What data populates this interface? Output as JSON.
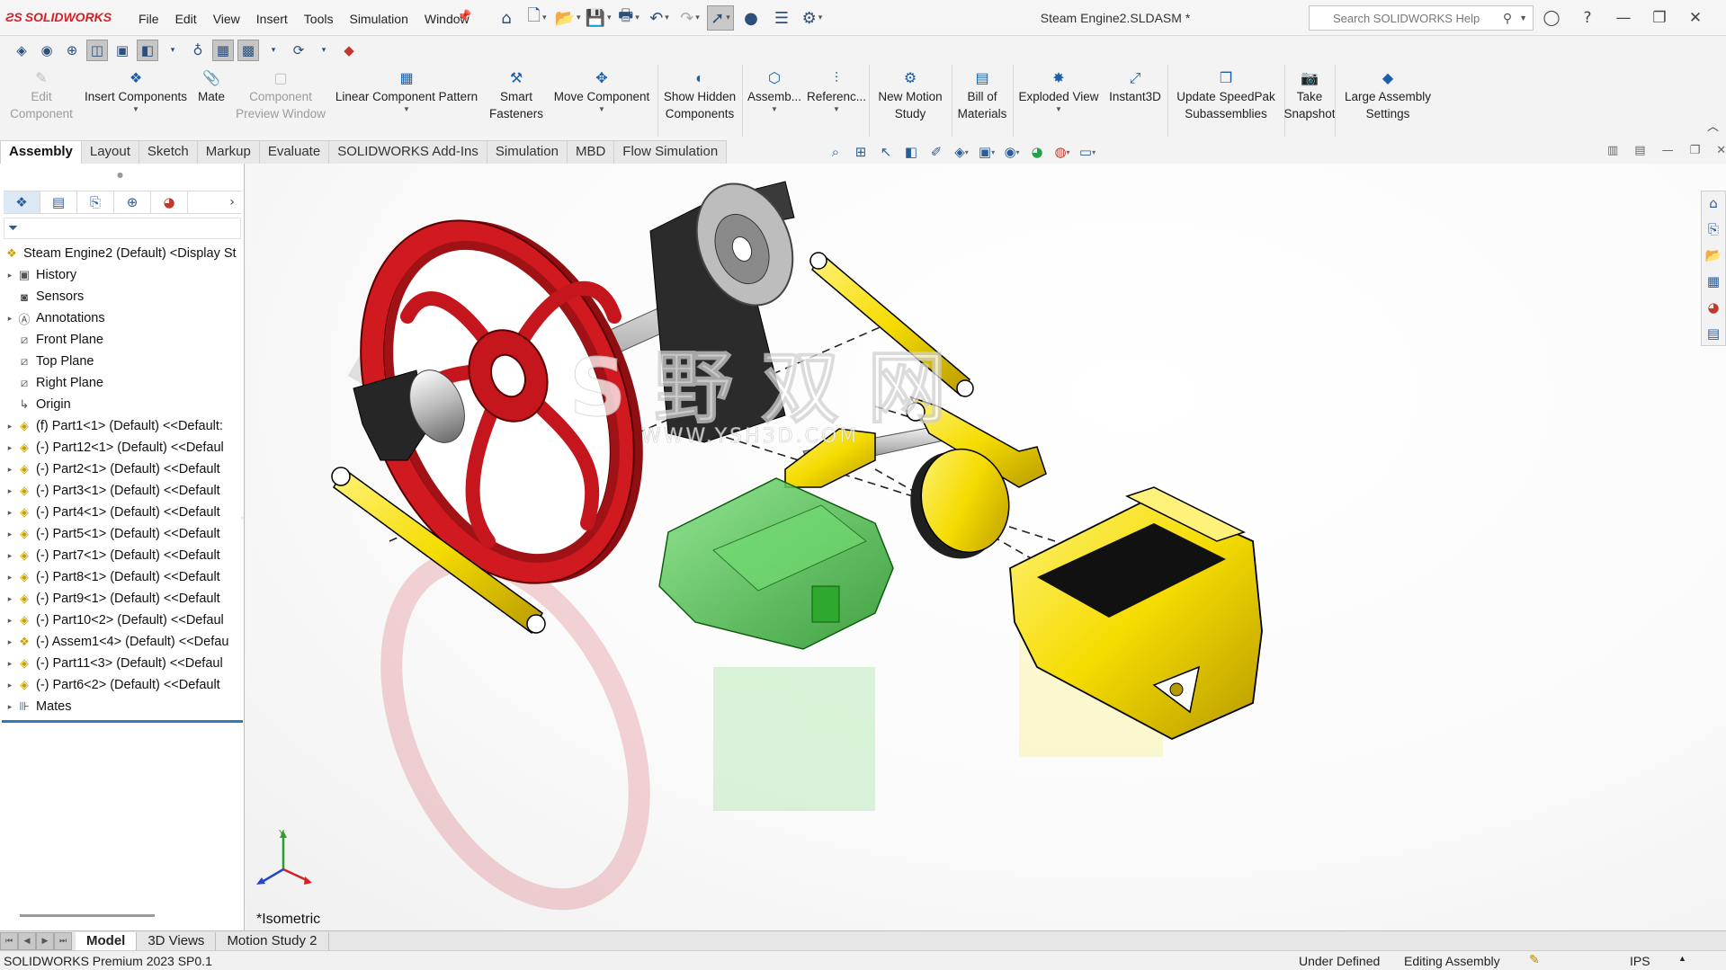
{
  "app": {
    "logo_text": "SOLIDWORKS",
    "document_title": "Steam Engine2.SLDASM *"
  },
  "menu": [
    "File",
    "Edit",
    "View",
    "Insert",
    "Tools",
    "Simulation",
    "Window"
  ],
  "quick_tools": [
    "home-icon",
    "new-document-icon",
    "open-icon",
    "save-icon",
    "print-icon",
    "undo-icon",
    "redo-icon",
    "select-icon",
    "traffic-light-icon",
    "file-properties-icon",
    "options-icon"
  ],
  "help_search": {
    "placeholder": "Search SOLIDWORKS Help"
  },
  "command_manager": {
    "commands": [
      {
        "label": "Edit\nComponent",
        "icon": "edit-component-icon",
        "enabled": false
      },
      {
        "label": "Insert Components",
        "icon": "insert-components-icon",
        "enabled": true,
        "dropdown": true
      },
      {
        "label": "Mate",
        "icon": "paperclip-icon",
        "enabled": true
      },
      {
        "label": "Component\nPreview Window",
        "icon": "preview-window-icon",
        "enabled": false
      },
      {
        "label": "Linear Component Pattern",
        "icon": "pattern-icon",
        "enabled": true,
        "dropdown": true
      },
      {
        "label": "Smart\nFasteners",
        "icon": "fasteners-icon",
        "enabled": true
      },
      {
        "label": "Move Component",
        "icon": "move-component-icon",
        "enabled": true,
        "dropdown": true
      },
      {
        "label": "Show Hidden\nComponents",
        "icon": "show-hidden-icon",
        "enabled": true
      },
      {
        "label": "Assemb...",
        "icon": "assembly-features-icon",
        "enabled": true,
        "dropdown": true
      },
      {
        "label": "Referenc...",
        "icon": "reference-geometry-icon",
        "enabled": true,
        "dropdown": true
      },
      {
        "label": "New Motion\nStudy",
        "icon": "motion-study-icon",
        "enabled": true
      },
      {
        "label": "Bill of\nMaterials",
        "icon": "bom-icon",
        "enabled": true
      },
      {
        "label": "Exploded View",
        "icon": "exploded-view-icon",
        "enabled": true,
        "dropdown": true
      },
      {
        "label": "Instant3D",
        "icon": "instant3d-icon",
        "enabled": true
      },
      {
        "label": "Update SpeedPak\nSubassemblies",
        "icon": "speedpak-icon",
        "enabled": true
      },
      {
        "label": "Take\nSnapshot",
        "icon": "camera-icon",
        "enabled": true
      },
      {
        "label": "Large Assembly\nSettings",
        "icon": "large-assembly-icon",
        "enabled": true
      }
    ]
  },
  "cm_tabs": [
    "Assembly",
    "Layout",
    "Sketch",
    "Markup",
    "Evaluate",
    "SOLIDWORKS Add-Ins",
    "Simulation",
    "MBD",
    "Flow Simulation"
  ],
  "active_cm_tab": "Assembly",
  "feature_tree": {
    "root": "Steam Engine2 (Default) <Display St",
    "items": [
      {
        "label": "History",
        "icon": "history-icon",
        "expandable": true
      },
      {
        "label": "Sensors",
        "icon": "sensor-icon",
        "expandable": false
      },
      {
        "label": "Annotations",
        "icon": "annotations-icon",
        "expandable": true
      },
      {
        "label": "Front Plane",
        "icon": "plane-icon",
        "expandable": false
      },
      {
        "label": "Top Plane",
        "icon": "plane-icon",
        "expandable": false
      },
      {
        "label": "Right Plane",
        "icon": "plane-icon",
        "expandable": false
      },
      {
        "label": "Origin",
        "icon": "origin-icon",
        "expandable": false
      },
      {
        "label": "(f) Part1<1> (Default) <<Default:",
        "icon": "part-icon",
        "expandable": true
      },
      {
        "label": "(-) Part12<1> (Default) <<Defaul",
        "icon": "part-icon",
        "expandable": true
      },
      {
        "label": "(-) Part2<1> (Default) <<Default",
        "icon": "part-icon",
        "expandable": true
      },
      {
        "label": "(-) Part3<1> (Default) <<Default",
        "icon": "part-icon",
        "expandable": true
      },
      {
        "label": "(-) Part4<1> (Default) <<Default",
        "icon": "part-icon",
        "expandable": true
      },
      {
        "label": "(-) Part5<1> (Default) <<Default",
        "icon": "part-icon",
        "expandable": true
      },
      {
        "label": "(-) Part7<1> (Default) <<Default",
        "icon": "part-icon",
        "expandable": true
      },
      {
        "label": "(-) Part8<1> (Default) <<Default",
        "icon": "part-icon",
        "expandable": true
      },
      {
        "label": "(-) Part9<1> (Default) <<Default",
        "icon": "part-icon",
        "expandable": true
      },
      {
        "label": "(-) Part10<2> (Default) <<Defaul",
        "icon": "part-icon",
        "expandable": true
      },
      {
        "label": "(-) Assem1<4> (Default) <<Defau",
        "icon": "subassembly-icon",
        "expandable": true
      },
      {
        "label": "(-) Part11<3> (Default) <<Defaul",
        "icon": "part-icon",
        "expandable": true
      },
      {
        "label": "(-) Part6<2> (Default) <<Default",
        "icon": "part-icon",
        "expandable": true
      },
      {
        "label": "Mates",
        "icon": "mates-icon",
        "expandable": true
      }
    ]
  },
  "graphics": {
    "view_name": "*Isometric",
    "watermark_text": "WWW.YSH3D.COM",
    "colors": {
      "flywheel": "#c4161c",
      "links": "#f2d000",
      "cylinder": "#3dc43d",
      "frame": "#2b2b2b",
      "base": "#f5e000"
    }
  },
  "bottom_tabs": [
    "Model",
    "3D Views",
    "Motion Study 2"
  ],
  "active_bottom_tab": "Model",
  "status": {
    "version": "SOLIDWORKS Premium 2023 SP0.1",
    "definition": "Under Defined",
    "mode": "Editing Assembly",
    "units": "IPS"
  }
}
